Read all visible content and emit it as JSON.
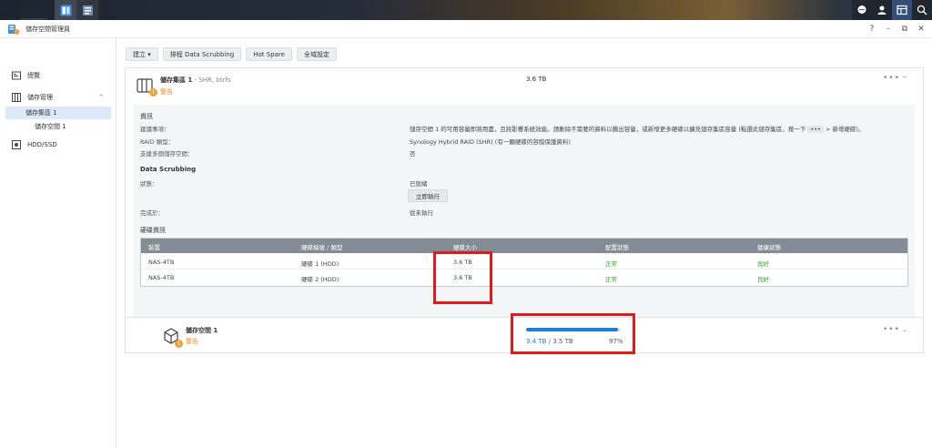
{
  "window": {
    "title": "儲存空間管理員"
  },
  "sidebar": {
    "items": [
      {
        "label": "總覽"
      },
      {
        "label": "儲存管理"
      },
      {
        "label": "儲存集區 1"
      },
      {
        "label": "儲存空間 1"
      },
      {
        "label": "HDD/SSD"
      }
    ]
  },
  "toolbar": {
    "create": "建立",
    "scrub": "排程 Data Scrubbing",
    "hotspare": "Hot Spare",
    "global": "全域設定"
  },
  "pool": {
    "name": "儲存集區 1",
    "meta": " - SHR, btrfs",
    "status": "警告",
    "capacity": "3.6 TB",
    "info_title": "資訊",
    "suggestion_label": "建議事項：",
    "suggestion_text": "儲存空間 1 的可用容量即將用盡，且將影響系統效能。請刪除不需要的資料以騰出容量，或新增更多硬碟以擴充儲存集區容量 (點選此儲存集區，按一下",
    "suggestion_dots": "•••",
    "suggestion_tail": "> 新增硬碟)。",
    "raid_label": "RAID 類型：",
    "raid_value": "Synology Hybrid RAID (SHR) (有一顆硬碟的容錯保護資料)",
    "multi_label": "支援多個儲存空間：",
    "multi_value": "否",
    "scrub_title": "Data Scrubbing",
    "scrub_status_label": "狀態：",
    "scrub_status_value": "已就緒",
    "scrub_run_button": "立即執行",
    "scrub_done_label": "完成於：",
    "scrub_done_value": "從未執行",
    "disk_info_title": "硬碟資訊",
    "disk_table": {
      "headers": [
        "裝置",
        "硬碟編號 / 類型",
        "硬碟大小",
        "配置狀態",
        "健康狀態"
      ],
      "rows": [
        [
          "NAS-4TB",
          "硬碟 1 (HDD)",
          "3.6 TB",
          "正常",
          "良好"
        ],
        [
          "NAS-4TB",
          "硬碟 2 (HDD)",
          "3.6 TB",
          "正常",
          "良好"
        ]
      ]
    }
  },
  "volume": {
    "name": "儲存空間 1",
    "status": "警告",
    "used": "3.4 TB",
    "separator": " / ",
    "total": "3.5 TB",
    "percent": "97%",
    "usage_fraction": 0.97
  },
  "colors": {
    "accent": "#1a7fd6",
    "warning": "#f08c1a",
    "ok": "#2aa42a",
    "highlight": "#e01b1b"
  },
  "icons": {
    "taskbar": [
      "main-menu-icon",
      "storage-manager-icon",
      "app-icon"
    ],
    "taskbar_right": [
      "chat-icon",
      "user-icon",
      "widgets-icon",
      "search-icon"
    ],
    "window_controls": [
      "help-icon",
      "minimize-icon",
      "restore-icon",
      "close-icon"
    ]
  }
}
